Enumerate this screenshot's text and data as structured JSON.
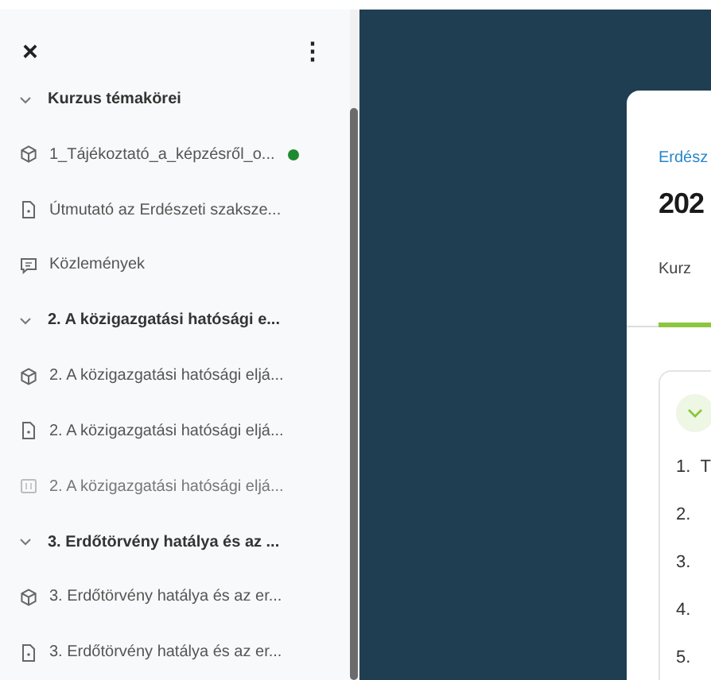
{
  "sidebar": {
    "close": "×",
    "menu": "⋮",
    "sections": [
      {
        "title": "Kurzus témakörei",
        "expanded": true,
        "items": [
          {
            "kind": "package",
            "label": "1_Tájékoztató_a_képzésről_o...",
            "color": "#1e8a2e",
            "dimmed": false
          },
          {
            "kind": "file",
            "label": "Útmutató az Erdészeti szaksze...",
            "dimmed": false
          },
          {
            "kind": "forum",
            "label": "Közlemények",
            "dimmed": false
          }
        ]
      },
      {
        "title": "2. A közigazgatási hatósági e...",
        "expanded": true,
        "items": [
          {
            "kind": "package",
            "label": "2. A közigazgatási hatósági eljá...",
            "dimmed": false
          },
          {
            "kind": "file",
            "label": "2. A közigazgatási hatósági eljá...",
            "dimmed": false
          },
          {
            "kind": "page",
            "label": "2. A közigazgatási hatósági eljá...",
            "dimmed": true
          }
        ]
      },
      {
        "title": "3. Erdőtörvény hatálya és az ...",
        "expanded": true,
        "items": [
          {
            "kind": "package",
            "label": "3. Erdőtörvény hatálya és az er...",
            "dimmed": false
          },
          {
            "kind": "file",
            "label": "3. Erdőtörvény hatálya és az er...",
            "dimmed": false
          }
        ]
      }
    ]
  },
  "main": {
    "breadcrumb": "Erdész",
    "title": "202",
    "tabs": [
      {
        "label": "Kurz",
        "selected": true
      }
    ],
    "list": [
      {
        "number": "1.",
        "text": "T"
      },
      {
        "number": "2."
      },
      {
        "number": "3."
      },
      {
        "number": "4."
      },
      {
        "number": "5."
      }
    ]
  }
}
